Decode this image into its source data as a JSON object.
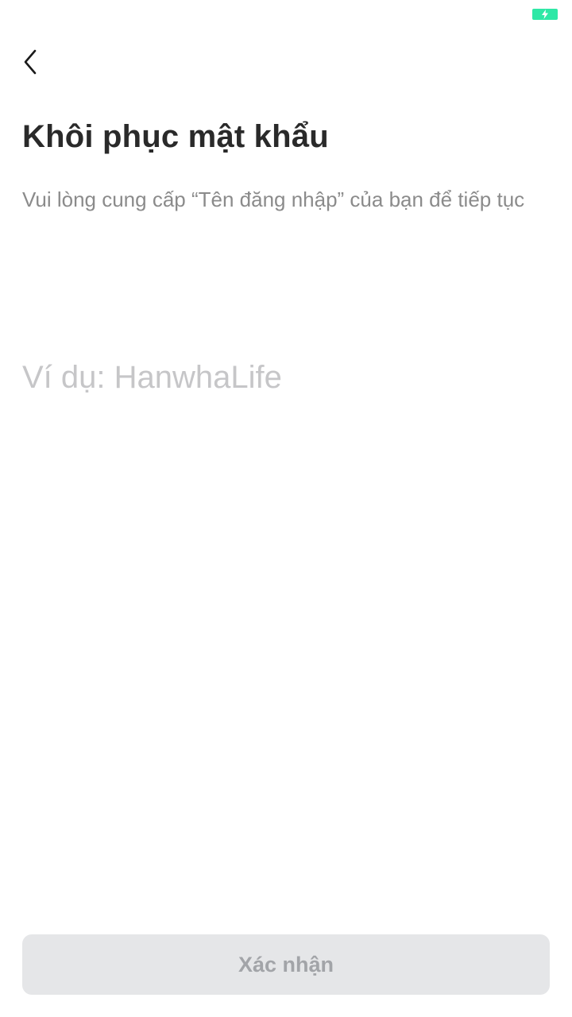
{
  "status_bar": {
    "battery_icon": "battery-charging-icon",
    "battery_color": "#2ee8a6"
  },
  "nav": {
    "back_icon": "chevron-left-icon"
  },
  "header": {
    "title": "Khôi phục mật khẩu",
    "subtitle": "Vui lòng cung cấp “Tên đăng nhập” của bạn để tiếp tục"
  },
  "form": {
    "username": {
      "value": "",
      "placeholder": "Ví dụ: HanwhaLife"
    }
  },
  "footer": {
    "confirm_label": "Xác nhận",
    "confirm_bg": "#e5e6e8",
    "confirm_text_color": "#a2a4a8"
  }
}
